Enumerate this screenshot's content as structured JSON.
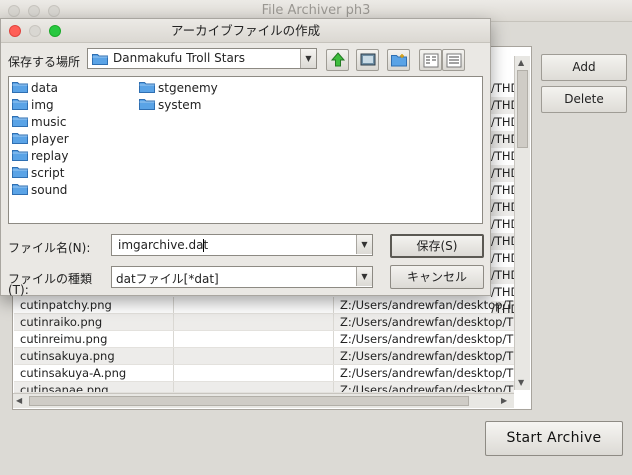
{
  "window": {
    "title": "File Archiver ph3",
    "buttons": {
      "add": "Add",
      "delete": "Delete",
      "start": "Start Archive"
    },
    "file_rows": [
      {
        "name": "cutinpatchy.png",
        "dir": "",
        "path": "Z:/Users/andrewfan/desktop/THD"
      },
      {
        "name": "cutinraiko.png",
        "dir": "",
        "path": "Z:/Users/andrewfan/desktop/THD"
      },
      {
        "name": "cutinreimu.png",
        "dir": "",
        "path": "Z:/Users/andrewfan/desktop/THD"
      },
      {
        "name": "cutinsakuya.png",
        "dir": "",
        "path": "Z:/Users/andrewfan/desktop/THD"
      },
      {
        "name": "cutinsakuya-A.png",
        "dir": "",
        "path": "Z:/Users/andrewfan/desktop/THD"
      },
      {
        "name": "cutinsanae.png",
        "dir": "",
        "path": "Z:/Users/andrewfan/desktop/THD"
      }
    ],
    "partial_path_fragment": "/THD"
  },
  "dialog": {
    "title": "アーカイブファイルの作成",
    "save_in_label": "保存する場所",
    "save_in_value": "Danmakufu Troll Stars",
    "folders_col1": [
      "data",
      "img",
      "music",
      "player",
      "replay",
      "script",
      "sound"
    ],
    "folders_col2": [
      "stgenemy",
      "system"
    ],
    "filename_label": "ファイル名(N):",
    "filename_value": "imgarchive.dat",
    "filetype_label": "ファイルの種類",
    "filetype_label2": "(T):",
    "filetype_value": "datファイル[*dat]",
    "save_button": "保存(S)",
    "cancel_button": "キャンセル"
  },
  "colors": {
    "close": "#ff5f57",
    "minimize": "#febc2e",
    "zoom": "#28c840",
    "folder": "#5aa3e6"
  },
  "icons": [
    "folder-icon",
    "up-folder-icon",
    "desktop-icon",
    "new-folder-icon",
    "list-view-icon",
    "details-view-icon"
  ]
}
